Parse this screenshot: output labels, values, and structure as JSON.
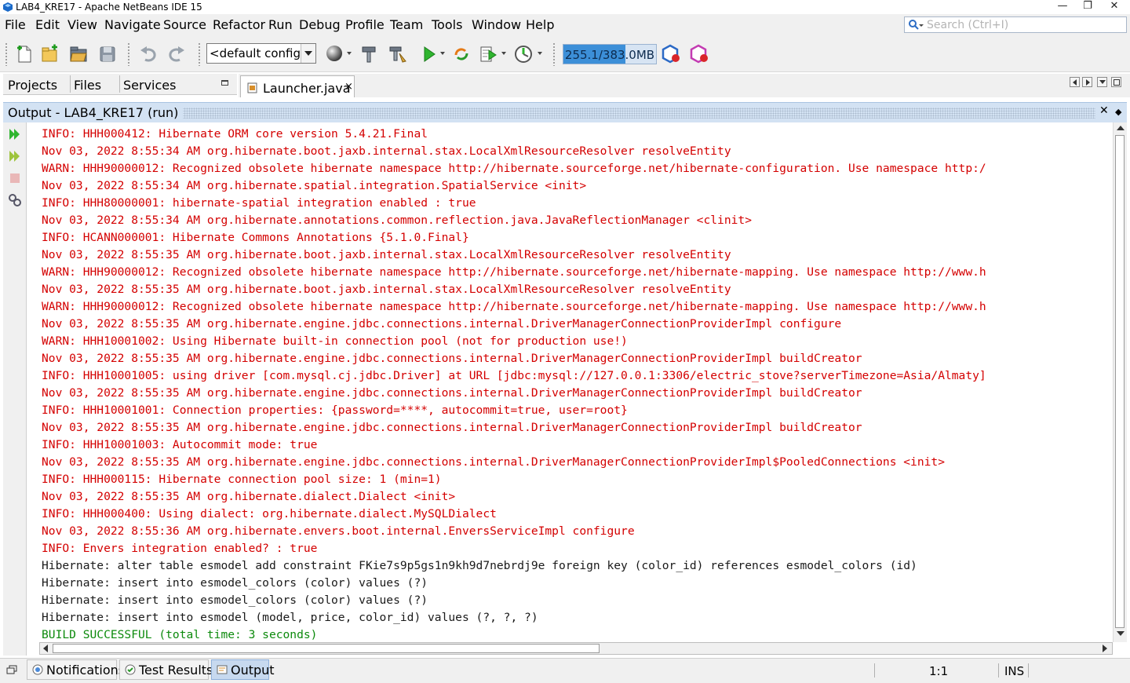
{
  "window": {
    "title": "LAB4_KRE17 - Apache NetBeans IDE 15",
    "minimize_glyph": "—",
    "restore_glyph": "❐",
    "close_glyph": "✕"
  },
  "menu": [
    "File",
    "Edit",
    "View",
    "Navigate",
    "Source",
    "Refactor",
    "Run",
    "Debug",
    "Profile",
    "Team",
    "Tools",
    "Window",
    "Help"
  ],
  "search": {
    "placeholder": "Search (Ctrl+I)",
    "icon": "search-icon"
  },
  "toolbar": {
    "config_value": "<default config>",
    "memory_label": "255.1/383.0MB",
    "memory_used_fraction": 0.666
  },
  "side_tabs": [
    "Projects",
    "Files",
    "Services"
  ],
  "editor_tab": {
    "label": "Launcher.java",
    "close": "×"
  },
  "output": {
    "title": "Output - LAB4_KRE17 (run)",
    "close": "✕",
    "menu": "◆",
    "lines": [
      {
        "text": "INFO: HHH000412: Hibernate ORM core version 5.4.21.Final",
        "kind": "error"
      },
      {
        "text": "Nov 03, 2022 8:55:34 AM org.hibernate.boot.jaxb.internal.stax.LocalXmlResourceResolver resolveEntity",
        "kind": "error"
      },
      {
        "text": "WARN: HHH90000012: Recognized obsolete hibernate namespace http://hibernate.sourceforge.net/hibernate-configuration. Use namespace http:/",
        "kind": "error"
      },
      {
        "text": "Nov 03, 2022 8:55:34 AM org.hibernate.spatial.integration.SpatialService <init>",
        "kind": "error"
      },
      {
        "text": "INFO: HHH80000001: hibernate-spatial integration enabled : true",
        "kind": "error"
      },
      {
        "text": "Nov 03, 2022 8:55:34 AM org.hibernate.annotations.common.reflection.java.JavaReflectionManager <clinit>",
        "kind": "error"
      },
      {
        "text": "INFO: HCANN000001: Hibernate Commons Annotations {5.1.0.Final}",
        "kind": "error"
      },
      {
        "text": "Nov 03, 2022 8:55:35 AM org.hibernate.boot.jaxb.internal.stax.LocalXmlResourceResolver resolveEntity",
        "kind": "error"
      },
      {
        "text": "WARN: HHH90000012: Recognized obsolete hibernate namespace http://hibernate.sourceforge.net/hibernate-mapping. Use namespace http://www.h",
        "kind": "error"
      },
      {
        "text": "Nov 03, 2022 8:55:35 AM org.hibernate.boot.jaxb.internal.stax.LocalXmlResourceResolver resolveEntity",
        "kind": "error"
      },
      {
        "text": "WARN: HHH90000012: Recognized obsolete hibernate namespace http://hibernate.sourceforge.net/hibernate-mapping. Use namespace http://www.h",
        "kind": "error"
      },
      {
        "text": "Nov 03, 2022 8:55:35 AM org.hibernate.engine.jdbc.connections.internal.DriverManagerConnectionProviderImpl configure",
        "kind": "error"
      },
      {
        "text": "WARN: HHH10001002: Using Hibernate built-in connection pool (not for production use!)",
        "kind": "error"
      },
      {
        "text": "Nov 03, 2022 8:55:35 AM org.hibernate.engine.jdbc.connections.internal.DriverManagerConnectionProviderImpl buildCreator",
        "kind": "error"
      },
      {
        "text": "INFO: HHH10001005: using driver [com.mysql.cj.jdbc.Driver] at URL [jdbc:mysql://127.0.0.1:3306/electric_stove?serverTimezone=Asia/Almaty]",
        "kind": "error"
      },
      {
        "text": "Nov 03, 2022 8:55:35 AM org.hibernate.engine.jdbc.connections.internal.DriverManagerConnectionProviderImpl buildCreator",
        "kind": "error"
      },
      {
        "text": "INFO: HHH10001001: Connection properties: {password=****, autocommit=true, user=root}",
        "kind": "error"
      },
      {
        "text": "Nov 03, 2022 8:55:35 AM org.hibernate.engine.jdbc.connections.internal.DriverManagerConnectionProviderImpl buildCreator",
        "kind": "error"
      },
      {
        "text": "INFO: HHH10001003: Autocommit mode: true",
        "kind": "error"
      },
      {
        "text": "Nov 03, 2022 8:55:35 AM org.hibernate.engine.jdbc.connections.internal.DriverManagerConnectionProviderImpl$PooledConnections <init>",
        "kind": "error"
      },
      {
        "text": "INFO: HHH000115: Hibernate connection pool size: 1 (min=1)",
        "kind": "error"
      },
      {
        "text": "Nov 03, 2022 8:55:35 AM org.hibernate.dialect.Dialect <init>",
        "kind": "error"
      },
      {
        "text": "INFO: HHH000400: Using dialect: org.hibernate.dialect.MySQLDialect",
        "kind": "error"
      },
      {
        "text": "Nov 03, 2022 8:55:36 AM org.hibernate.envers.boot.internal.EnversServiceImpl configure",
        "kind": "error"
      },
      {
        "text": "INFO: Envers integration enabled? : true",
        "kind": "error"
      },
      {
        "text": "Hibernate: alter table esmodel add constraint FKie7s9p5gs1n9kh9d7nebrdj9e foreign key (color_id) references esmodel_colors (id)",
        "kind": "plain"
      },
      {
        "text": "Hibernate: insert into esmodel_colors (color) values (?)",
        "kind": "plain"
      },
      {
        "text": "Hibernate: insert into esmodel_colors (color) values (?)",
        "kind": "plain"
      },
      {
        "text": "Hibernate: insert into esmodel (model, price, color_id) values (?, ?, ?)",
        "kind": "plain"
      },
      {
        "text": "BUILD SUCCESSFUL (total time: 3 seconds)",
        "kind": "success"
      }
    ]
  },
  "status_bar": {
    "buttons": [
      {
        "label": "Notifications",
        "icon": "notifications-icon",
        "active": false
      },
      {
        "label": "Test Results",
        "icon": "test-results-icon",
        "active": false
      },
      {
        "label": "Output",
        "icon": "output-icon",
        "active": true
      }
    ],
    "caret_position": "1:1",
    "insert_mode": "INS"
  },
  "colors": {
    "error_text": "#d40000",
    "plain_text": "#1a1a1a",
    "success_text": "#0c8a0c",
    "panel_header": "#d3e2f3",
    "memory_fill": "#3c8fd8"
  }
}
